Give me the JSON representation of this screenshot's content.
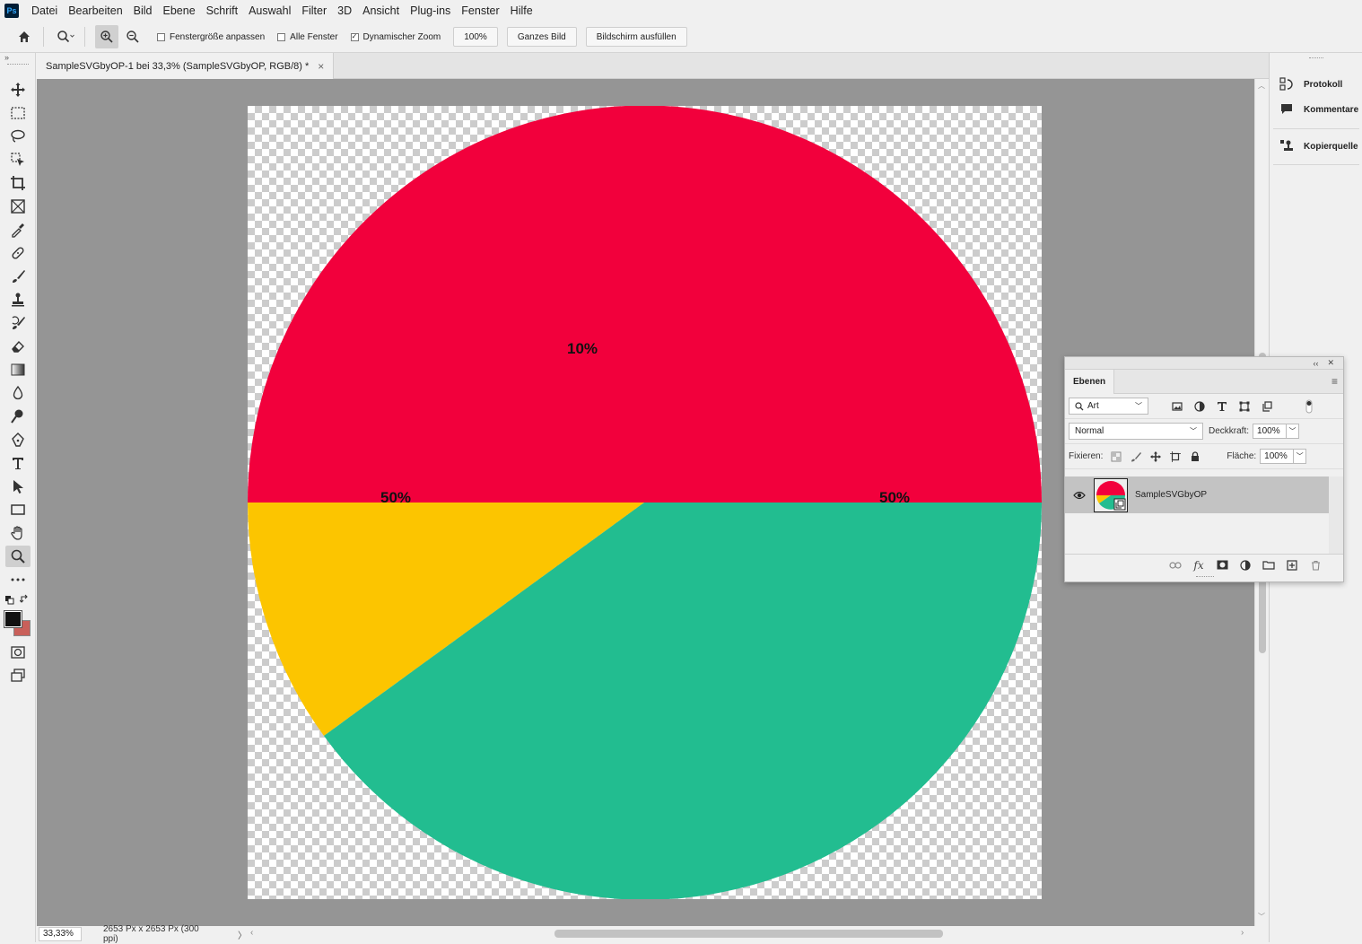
{
  "app": {
    "logo": "Ps"
  },
  "menu": [
    "Datei",
    "Bearbeiten",
    "Bild",
    "Ebene",
    "Schrift",
    "Auswahl",
    "Filter",
    "3D",
    "Ansicht",
    "Plug-ins",
    "Fenster",
    "Hilfe"
  ],
  "options": {
    "fit_window_label": "Fenstergröße anpassen",
    "fit_window_checked": false,
    "all_windows_label": "Alle Fenster",
    "all_windows_checked": false,
    "dynamic_zoom_label": "Dynamischer Zoom",
    "dynamic_zoom_checked": true,
    "zoom_value": "100%",
    "whole_image_label": "Ganzes Bild",
    "fill_screen_label": "Bildschirm ausfüllen"
  },
  "document": {
    "tab_title": "SampleSVGbyOP-1 bei 33,3% (SampleSVGbyOP, RGB/8) *",
    "tab_close": "×"
  },
  "pie": {
    "slices": [
      {
        "label": "10%",
        "color": "#f2003c"
      },
      {
        "label": "50%",
        "color": "#fcc500"
      },
      {
        "label": "50%",
        "color": "#22bd90"
      }
    ]
  },
  "status": {
    "zoom": "33,33%",
    "doc_info": "2653 Px x 2653 Px (300 ppi)",
    "arrow": "〉"
  },
  "right_dock": {
    "items": [
      "Protokoll",
      "Kommentare",
      "Kopierquelle"
    ]
  },
  "layers_panel": {
    "tab": "Ebenen",
    "filter_kind": "Art",
    "blend_mode": "Normal",
    "opacity_label": "Deckkraft:",
    "opacity_value": "100%",
    "lock_label": "Fixieren:",
    "fill_label": "Fläche:",
    "fill_value": "100%",
    "layers": [
      {
        "name": "SampleSVGbyOP",
        "visible": true
      }
    ]
  },
  "colors": {
    "foreground": "#111111",
    "background": "#c9605a"
  }
}
